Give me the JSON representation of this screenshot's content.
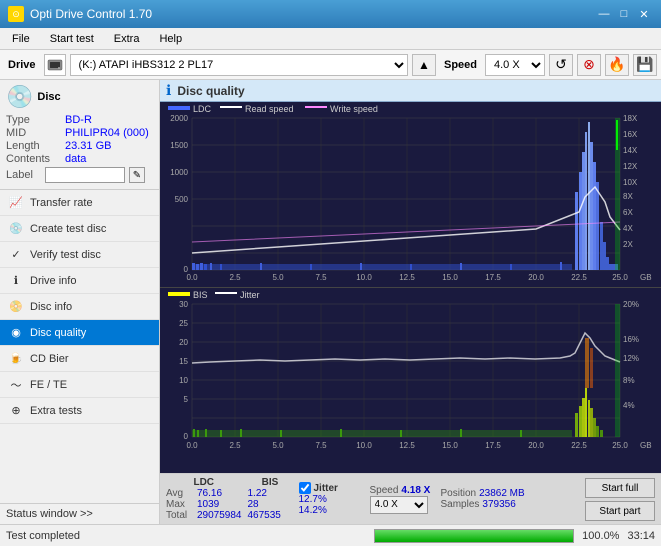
{
  "app": {
    "title": "Opti Drive Control 1.70",
    "icon": "⊙"
  },
  "titlebar": {
    "minimize": "—",
    "maximize": "□",
    "close": "✕"
  },
  "menubar": {
    "items": [
      "File",
      "Start test",
      "Extra",
      "Help"
    ]
  },
  "drive_toolbar": {
    "drive_label": "Drive",
    "drive_value": "(K:)  ATAPI iHBS312  2 PL17",
    "speed_label": "Speed",
    "speed_value": "4.0 X"
  },
  "disc": {
    "type_label": "Type",
    "type_value": "BD-R",
    "mid_label": "MID",
    "mid_value": "PHILIPR04 (000)",
    "length_label": "Length",
    "length_value": "23.31 GB",
    "contents_label": "Contents",
    "contents_value": "data",
    "label_label": "Label"
  },
  "nav": {
    "items": [
      {
        "id": "transfer-rate",
        "label": "Transfer rate",
        "icon": "📈"
      },
      {
        "id": "create-test-disc",
        "label": "Create test disc",
        "icon": "💿"
      },
      {
        "id": "verify-test-disc",
        "label": "Verify test disc",
        "icon": "✓"
      },
      {
        "id": "drive-info",
        "label": "Drive info",
        "icon": "ℹ"
      },
      {
        "id": "disc-info",
        "label": "Disc info",
        "icon": "📀"
      },
      {
        "id": "disc-quality",
        "label": "Disc quality",
        "icon": "◉",
        "active": true
      },
      {
        "id": "cd-bier",
        "label": "CD Bier",
        "icon": "🍺"
      },
      {
        "id": "fe-te",
        "label": "FE / TE",
        "icon": "~"
      },
      {
        "id": "extra-tests",
        "label": "Extra tests",
        "icon": "⊕"
      }
    ]
  },
  "status_window": {
    "label": "Status window >> "
  },
  "disc_quality": {
    "title": "Disc quality",
    "legend": {
      "ldc": {
        "label": "LDC",
        "color": "#4466ff"
      },
      "read_speed": {
        "label": "Read speed",
        "color": "#ffffff"
      },
      "write_speed": {
        "label": "Write speed",
        "color": "#ff66ff"
      }
    },
    "legend2": {
      "bis": {
        "label": "BIS",
        "color": "#ffff00"
      },
      "jitter": {
        "label": "Jitter",
        "color": "#ffffff"
      }
    }
  },
  "stats": {
    "headers": [
      "LDC",
      "BIS",
      "",
      "Jitter",
      "Speed",
      ""
    ],
    "avg_label": "Avg",
    "max_label": "Max",
    "total_label": "Total",
    "ldc_avg": "76.16",
    "ldc_max": "1039",
    "ldc_total": "29075984",
    "bis_avg": "1.22",
    "bis_max": "28",
    "bis_total": "467535",
    "jitter_checked": true,
    "jitter_label": "Jitter",
    "jitter_avg": "12.7%",
    "jitter_max": "14.2%",
    "speed_label": "Speed",
    "speed_value": "4.18 X",
    "speed_select": "4.0 X",
    "position_label": "Position",
    "position_value": "23862 MB",
    "samples_label": "Samples",
    "samples_value": "379356",
    "start_full": "Start full",
    "start_part": "Start part"
  },
  "statusbar": {
    "text": "Test completed",
    "progress": 100,
    "progress_text": "100.0%",
    "time": "33:14"
  },
  "chart1": {
    "y_max": 2000,
    "y_labels": [
      "2000",
      "1500",
      "1000",
      "500",
      "0"
    ],
    "y2_labels": [
      "18X",
      "16X",
      "14X",
      "12X",
      "10X",
      "8X",
      "6X",
      "4X",
      "2X"
    ],
    "x_labels": [
      "0.0",
      "2.5",
      "5.0",
      "7.5",
      "10.0",
      "12.5",
      "15.0",
      "17.5",
      "20.0",
      "22.5",
      "25.0"
    ]
  },
  "chart2": {
    "y_max": 30,
    "y_labels": [
      "30",
      "25",
      "20",
      "15",
      "10",
      "5",
      "0"
    ],
    "y2_labels": [
      "20%",
      "16%",
      "12%",
      "8%",
      "4%"
    ],
    "x_labels": [
      "0.0",
      "2.5",
      "5.0",
      "7.5",
      "10.0",
      "12.5",
      "15.0",
      "17.5",
      "20.0",
      "22.5",
      "25.0"
    ]
  }
}
